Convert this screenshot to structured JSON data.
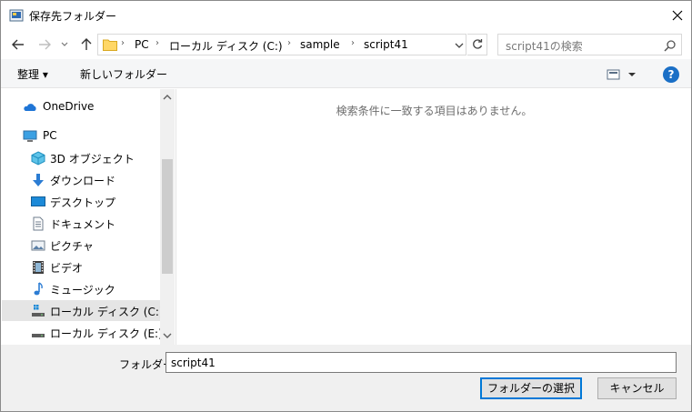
{
  "window": {
    "title": "保存先フォルダー"
  },
  "nav": {
    "breadcrumb": [
      "PC",
      "ローカル ディスク (C:)",
      "sample",
      "script41"
    ],
    "search_placeholder": "script41の検索"
  },
  "toolbar": {
    "organize_label": "整理 ▾",
    "new_folder_label": "新しいフォルダー",
    "help_label": "?"
  },
  "sidebar": {
    "items": [
      {
        "label": "OneDrive",
        "icon": "onedrive-icon"
      },
      {
        "label": "PC",
        "icon": "pc-icon"
      },
      {
        "label": "3D オブジェクト",
        "icon": "3d-objects-icon"
      },
      {
        "label": "ダウンロード",
        "icon": "download-icon"
      },
      {
        "label": "デスクトップ",
        "icon": "desktop-icon"
      },
      {
        "label": "ドキュメント",
        "icon": "documents-icon"
      },
      {
        "label": "ピクチャ",
        "icon": "pictures-icon"
      },
      {
        "label": "ビデオ",
        "icon": "video-icon"
      },
      {
        "label": "ミュージック",
        "icon": "music-icon"
      },
      {
        "label": "ローカル ディスク (C:)",
        "icon": "local-disk-icon",
        "selected": true
      },
      {
        "label": "ローカル ディスク (E:)",
        "icon": "local-disk-icon"
      }
    ]
  },
  "content": {
    "empty_message": "検索条件に一致する項目はありません。"
  },
  "footer": {
    "folder_label": "フォルダー:",
    "folder_value": "script41",
    "select_button": "フォルダーの選択",
    "cancel_button": "キャンセル"
  },
  "colors": {
    "accent": "#0078d7",
    "selected_bg": "#e5e5e5",
    "help_blue": "#1a6fc6"
  }
}
